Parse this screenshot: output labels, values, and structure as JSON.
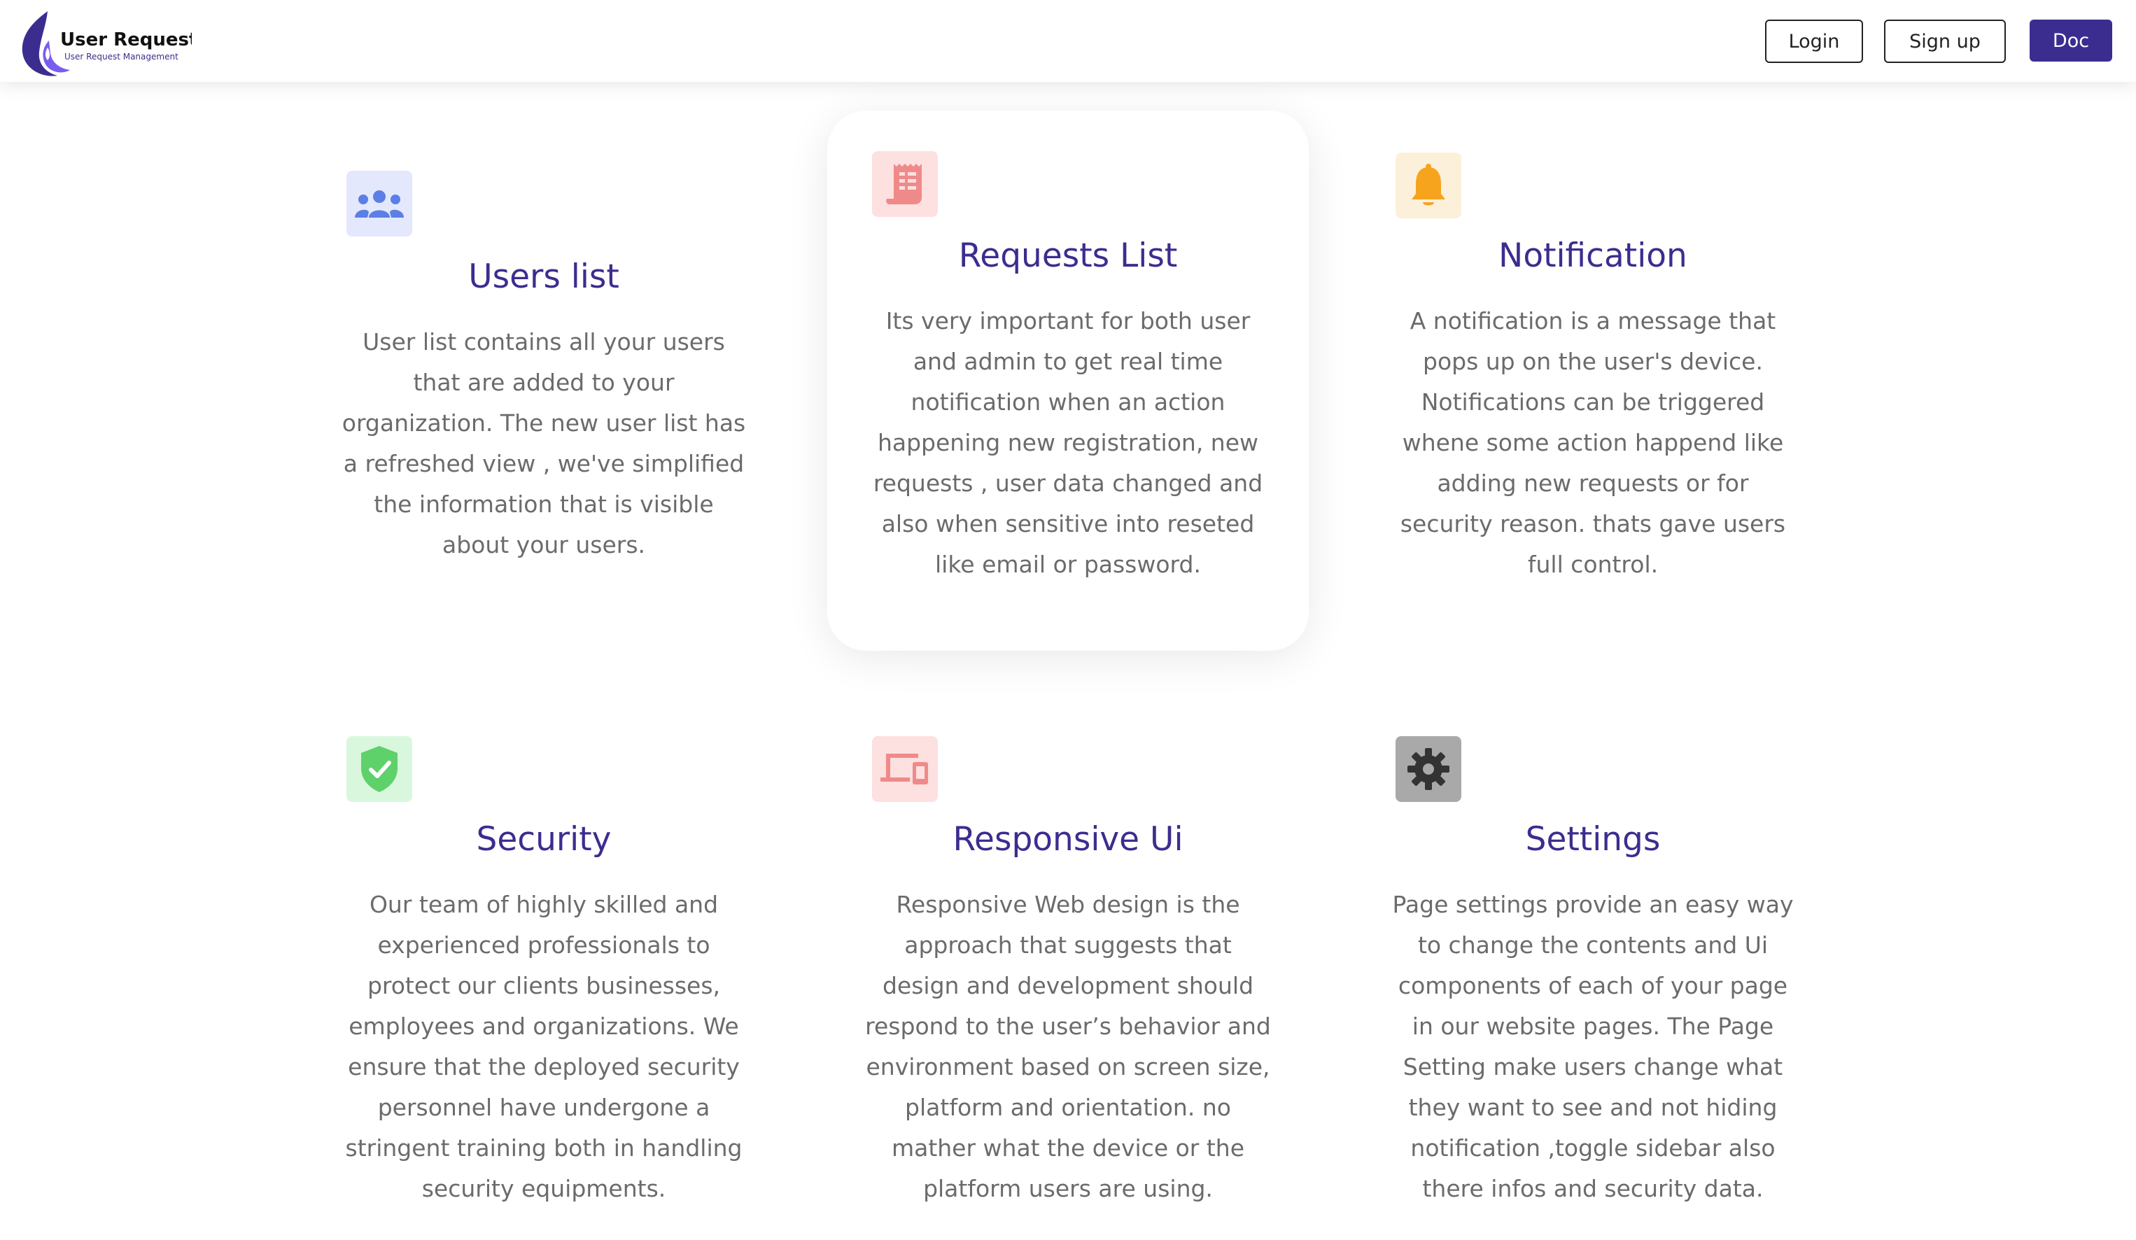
{
  "header": {
    "logo_title": "User Request",
    "logo_subtitle": "User Request Management",
    "login_label": "Login",
    "signup_label": "Sign up",
    "doc_label": "Doc"
  },
  "features": [
    {
      "title": "Users list",
      "icon": "users-icon",
      "lines": [
        "User list contains all your users",
        "that are added to your",
        "organization. The new user list has",
        "a refreshed view , we've simplified",
        "the information that is visible",
        "about your users."
      ]
    },
    {
      "title": "Requests List",
      "icon": "receipt-icon",
      "lines": [
        "Its very important for both user",
        "and admin to get real time",
        "notification when an action",
        "happening new registration, new",
        "requests , user data changed and",
        "also when sensitive into reseted",
        "like email or password."
      ]
    },
    {
      "title": "Notification",
      "icon": "bell-icon",
      "lines": [
        "A notification is a message that",
        "pops up on the user's device.",
        "Notifications can be triggered",
        "whene some action happend like",
        "adding new requests or for",
        "security reason. thats gave users",
        "full control."
      ]
    },
    {
      "title": "Security",
      "icon": "shield-check-icon",
      "lines": [
        "Our team of highly skilled and",
        "experienced professionals to",
        "protect our clients businesses,",
        "employees and organizations. We",
        "ensure that the deployed security",
        "personnel have undergone a",
        "stringent training both in handling",
        "security equipments."
      ]
    },
    {
      "title": "Responsive Ui",
      "icon": "devices-icon",
      "lines": [
        "Responsive Web design is the",
        "approach that suggests that",
        "design and development should",
        "respond to the user’s behavior and",
        "environment based on screen size,",
        "platform and orientation. no",
        "mather what the device or the",
        "platform users are using."
      ]
    },
    {
      "title": "Settings",
      "icon": "gear-icon",
      "lines": [
        "Page settings provide an easy way",
        "to change the contents and Ui",
        "components of each of your page",
        "in our website pages. The Page",
        "Setting make users change what",
        "they want to see and not hiding",
        "notification ,toggle sidebar also",
        "there infos and security data."
      ]
    }
  ],
  "colors": {
    "brand": "#3b2d8f",
    "users_icon_bg": "#e3e8fd",
    "users_icon": "#5b7fe6",
    "requests_icon_bg": "#fde0e0",
    "requests_icon": "#f08a8a",
    "bell_icon_bg": "#fdf0da",
    "bell_icon": "#f6a31e",
    "shield_icon_bg": "#d9f7dc",
    "shield_icon": "#5ed16b",
    "devices_icon_bg": "#fde0e0",
    "devices_icon": "#f08a8a",
    "gear_icon_bg": "#a9a9a9",
    "gear_icon": "#333333"
  }
}
